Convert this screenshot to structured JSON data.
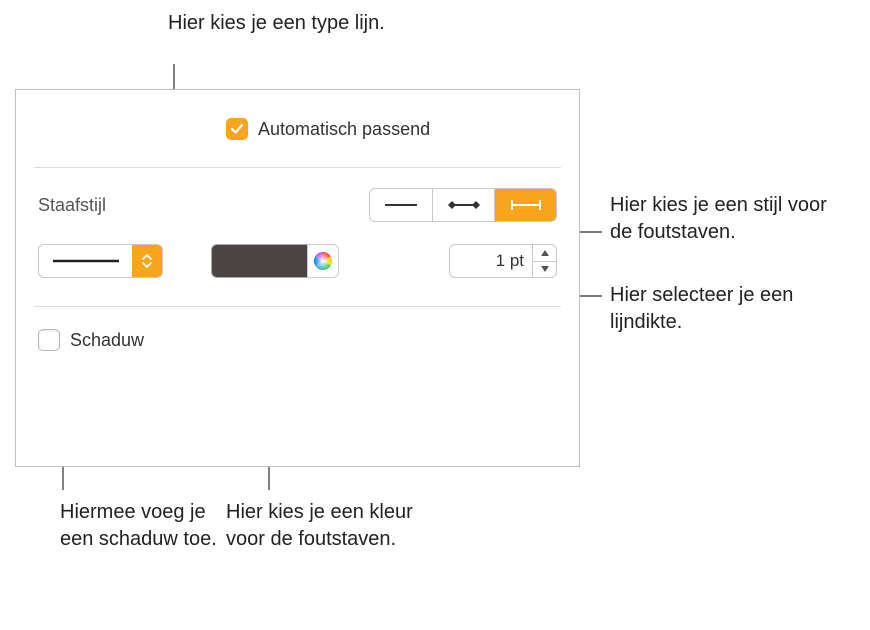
{
  "annotations": {
    "lineType": "Hier kies je een type lijn.",
    "barStyle": "Hier kies je een stijl voor de foutstaven.",
    "thickness": "Hier selecteer je een lijndikte.",
    "shadow": "Hiermee voeg je een schaduw toe.",
    "color": "Hier kies je een kleur voor de foutstaven."
  },
  "panel": {
    "autoFitLabel": "Automatisch passend",
    "barStyleLabel": "Staafstijl",
    "thicknessValue": "1 pt",
    "shadowLabel": "Schaduw"
  }
}
